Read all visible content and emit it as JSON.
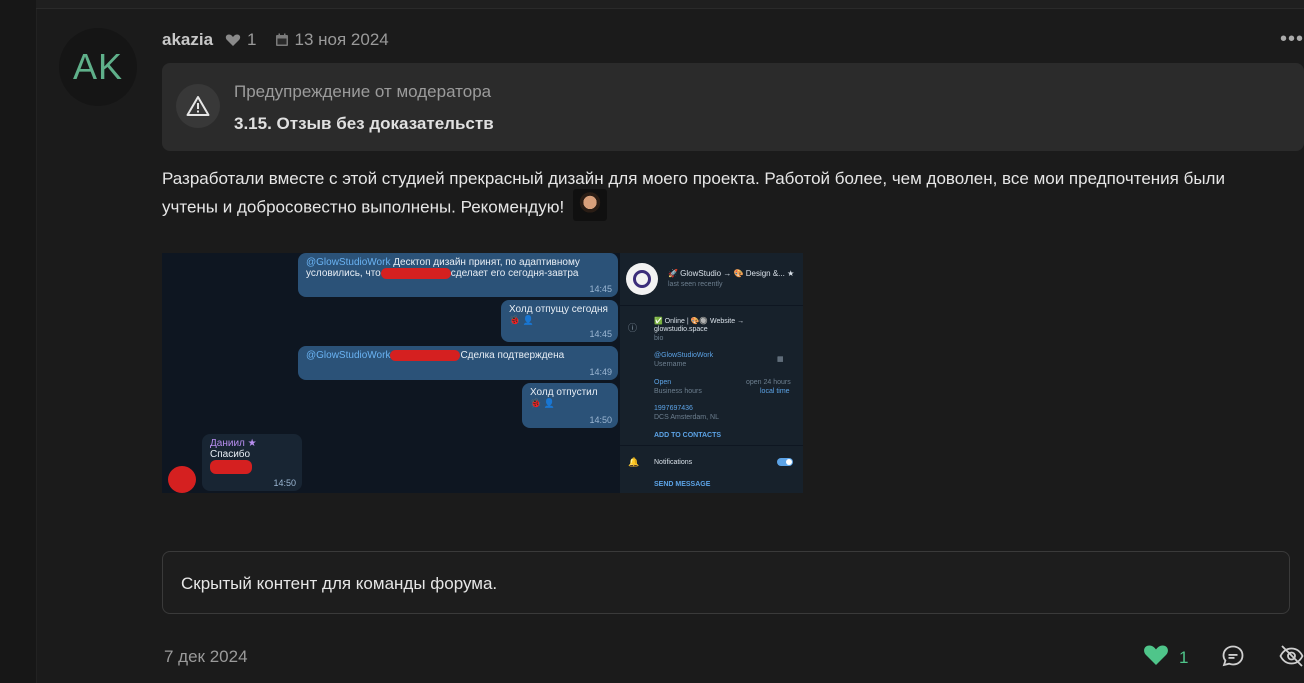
{
  "post": {
    "avatar_initials": "AK",
    "author": "akazia",
    "likes": "1",
    "date": "13 ноя 2024",
    "more_label": "•••",
    "warning": {
      "title": "Предупреждение от модератора",
      "text": "3.15. Отзыв без доказательств"
    },
    "body": "Разработали вместе с этой студией прекрасный дизайн для моего проекта. Работой более, чем доволен, все мои предпочтения были учтены и добросовестно выполнены. Рекомендую!",
    "hidden_content": "Скрытый контент для команды форума.",
    "edited_date": "7 дек 2024",
    "reaction_count": "1"
  },
  "screenshot": {
    "messages": [
      {
        "mention": "@GlowStudioWork",
        "text1": " Десктоп дизайн принят, по адаптивному",
        "text2": "условились, что",
        "text3": "сделает его сегодня-завтра",
        "time": "14:45"
      },
      {
        "text": "Холд отпущу сегодня",
        "time": "14:45"
      },
      {
        "mention": "@GlowStudioWork",
        "text": "Сделка подтверждена",
        "time": "14:49"
      },
      {
        "text": "Холд отпустил",
        "time": "14:50"
      },
      {
        "name": "Даниил ★",
        "text": "Спасибо",
        "time": "14:50"
      }
    ],
    "profile": {
      "title": "🚀 GlowStudio → 🎨 Design &... ★",
      "status": "last seen recently",
      "bio": "✅ Online | 🎨🔘 Website →",
      "site": "glowstudio.space",
      "bio_label": "bio",
      "username": "@GlowStudioWork",
      "username_label": "Username",
      "hours_open": "Open",
      "hours_value": "open 24 hours",
      "hours_label": "Business hours",
      "hours_local": "local time",
      "phone": "1997697436",
      "phone_label": "DCS Amsterdam, NL",
      "add_contacts": "ADD TO CONTACTS",
      "notifications": "Notifications",
      "send_message": "SEND MESSAGE"
    }
  },
  "colors": {
    "accent_green": "#4fc58a",
    "tg_bubble_out": "#2b5278",
    "redaction": "#d52020"
  }
}
